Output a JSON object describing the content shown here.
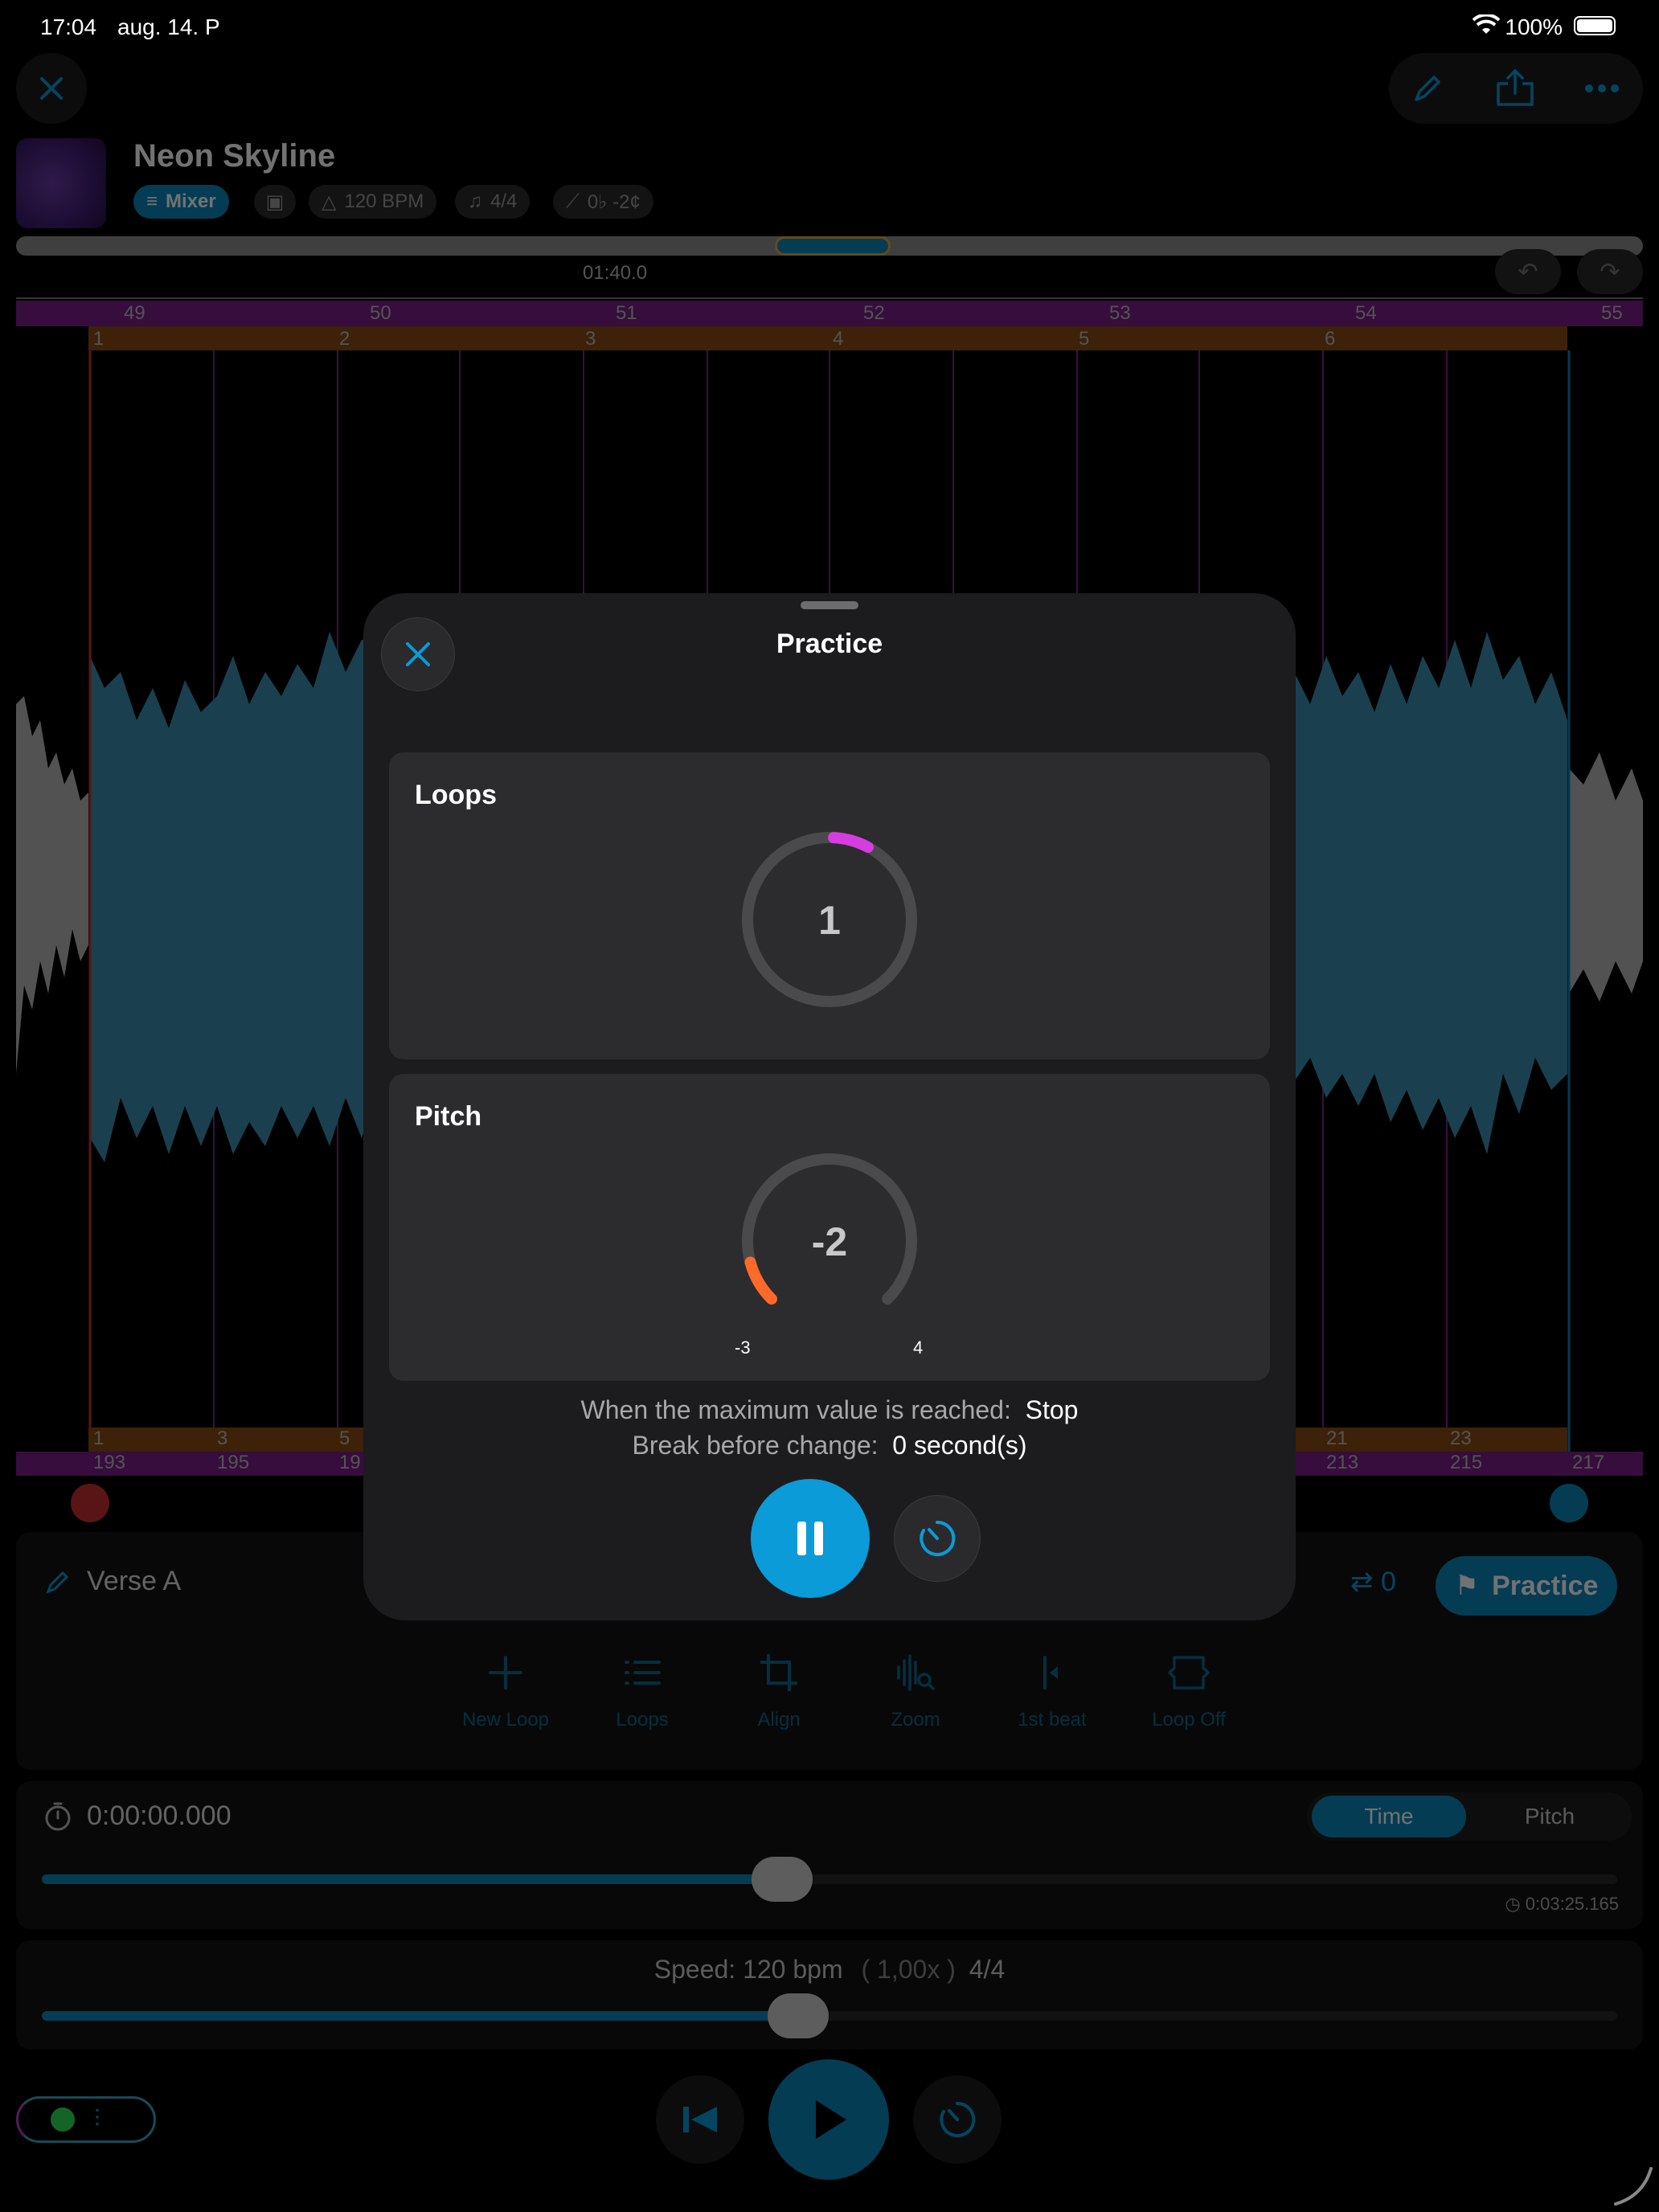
{
  "status_bar": {
    "time": "17:04",
    "date": "aug. 14. P",
    "battery": "100%"
  },
  "song": {
    "title": "Neon Skyline",
    "mixer_label": "Mixer",
    "bpm": "120 BPM",
    "time_signature": "4/4",
    "pitch": "0♭ -2¢"
  },
  "timeline": {
    "time_marker": "01:40.0",
    "bars_top": [
      "49",
      "50",
      "51",
      "52",
      "53",
      "54",
      "55"
    ],
    "beats_top": [
      "1",
      "2",
      "3",
      "4",
      "5",
      "6"
    ],
    "beats_bottom": [
      "1",
      "3",
      "5",
      "21",
      "23"
    ],
    "bars_bottom": [
      "193",
      "195",
      "19",
      "213",
      "215",
      "217"
    ]
  },
  "modal": {
    "title": "Practice",
    "loops_title": "Loops",
    "loops_value": "1",
    "loops_progress": 0.07,
    "pitch_title": "Pitch",
    "pitch_value": "-2",
    "pitch_min": "-3",
    "pitch_max": "4",
    "max_label": "When the maximum value is reached:",
    "max_value": "Stop",
    "break_label": "Break before change:",
    "break_value": "0 second(s)"
  },
  "loop_bar": {
    "name": "Verse A",
    "repeat_count": "0",
    "practice_label": "Practice"
  },
  "tools": [
    {
      "label": "New Loop",
      "icon": "plus-icon"
    },
    {
      "label": "Loops",
      "icon": "list-icon"
    },
    {
      "label": "Align",
      "icon": "crop-icon"
    },
    {
      "label": "Zoom",
      "icon": "waveform-zoom-icon"
    },
    {
      "label": "1st beat",
      "icon": "first-beat-icon"
    },
    {
      "label": "Loop Off",
      "icon": "loop-off-icon"
    }
  ],
  "position": {
    "elapsed": "0:00:00.000",
    "total": "0:03:25.165",
    "progress": 0.47,
    "tab_time": "Time",
    "tab_pitch": "Pitch"
  },
  "speed": {
    "prefix": "Speed:",
    "bpm": "120",
    "unit": "bpm",
    "factor": "( 1,00x )",
    "signature": "4/4",
    "progress": 0.48
  },
  "colors": {
    "accent": "#0a9bd8",
    "loop_magenta": "#d63de0",
    "pitch_orange": "#ff6a2b",
    "wave_blue": "#3b8fb0"
  }
}
